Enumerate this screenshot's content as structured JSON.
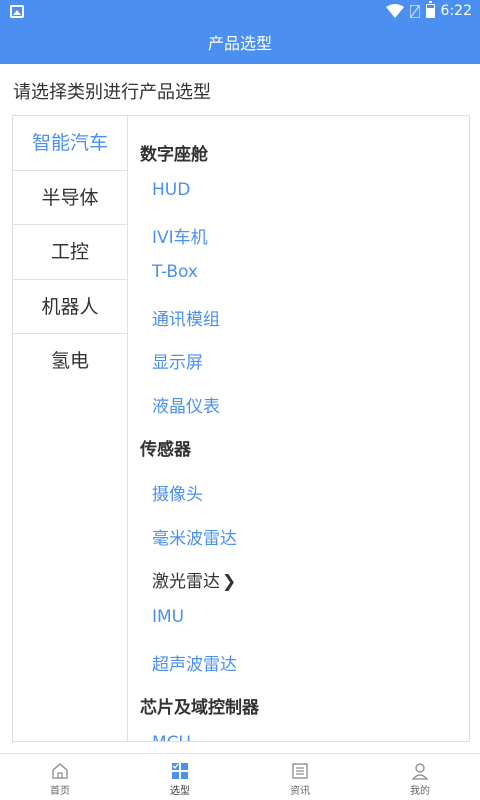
{
  "status": {
    "time": "6:22"
  },
  "header": {
    "title": "产品选型"
  },
  "subtitle": "请选择类别进行产品选型",
  "sidebar": {
    "items": [
      {
        "label": "智能汽车"
      },
      {
        "label": "半导体"
      },
      {
        "label": "工控"
      },
      {
        "label": "机器人"
      },
      {
        "label": "氢电"
      }
    ]
  },
  "content": {
    "sections": [
      {
        "title": "数字座舱",
        "items": [
          "HUD",
          "IVI车机",
          "T-Box",
          "通讯模组",
          "显示屏",
          "液晶仪表"
        ]
      },
      {
        "title": "传感器",
        "items": [
          "摄像头",
          "毫米波雷达",
          "激光雷达",
          "IMU",
          "超声波雷达"
        ]
      },
      {
        "title": "芯片及域控制器",
        "items": [
          "MCU"
        ]
      }
    ]
  },
  "nav": {
    "items": [
      {
        "label": "首页"
      },
      {
        "label": "选型"
      },
      {
        "label": "资讯"
      },
      {
        "label": "我的"
      }
    ]
  }
}
